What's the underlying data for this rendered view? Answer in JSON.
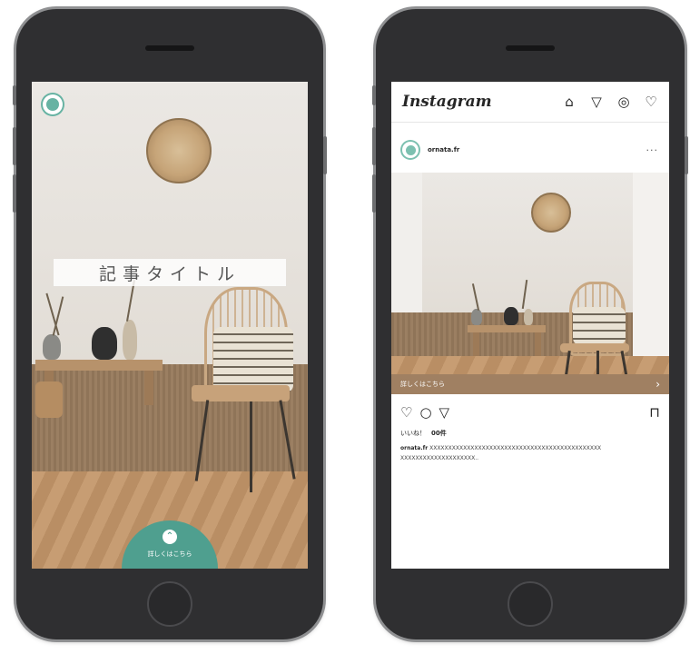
{
  "story_screen": {
    "avatar_icon": "brand-logo-avatar",
    "title": "記事タイトル",
    "cta_icon": "arrow-up-icon",
    "cta_label": "詳しくはこちら",
    "accent_color": "#4f9f8f"
  },
  "instagram_screen": {
    "app_title": "Instagram",
    "nav_icons": [
      "home-icon",
      "direct-message-icon",
      "explore-icon",
      "heart-icon"
    ],
    "post": {
      "username": "ornata.fr",
      "more_icon": "more-icon",
      "shop_label": "詳しくはこちら",
      "shop_arrow": "›",
      "action_icons": [
        "heart-icon",
        "comment-icon",
        "share-icon",
        "bookmark-icon"
      ],
      "likes_label": "いいね！",
      "likes_count": "00件",
      "caption_user": "ornata.fr",
      "caption_text": "XXXXXXXXXXXXXXXXXXXXXXXXXXXXXXXXXXXXXXXXXXXXXX XXXXXXXXXXXXXXXXXXXX.."
    },
    "accent_color": "#a08062"
  }
}
